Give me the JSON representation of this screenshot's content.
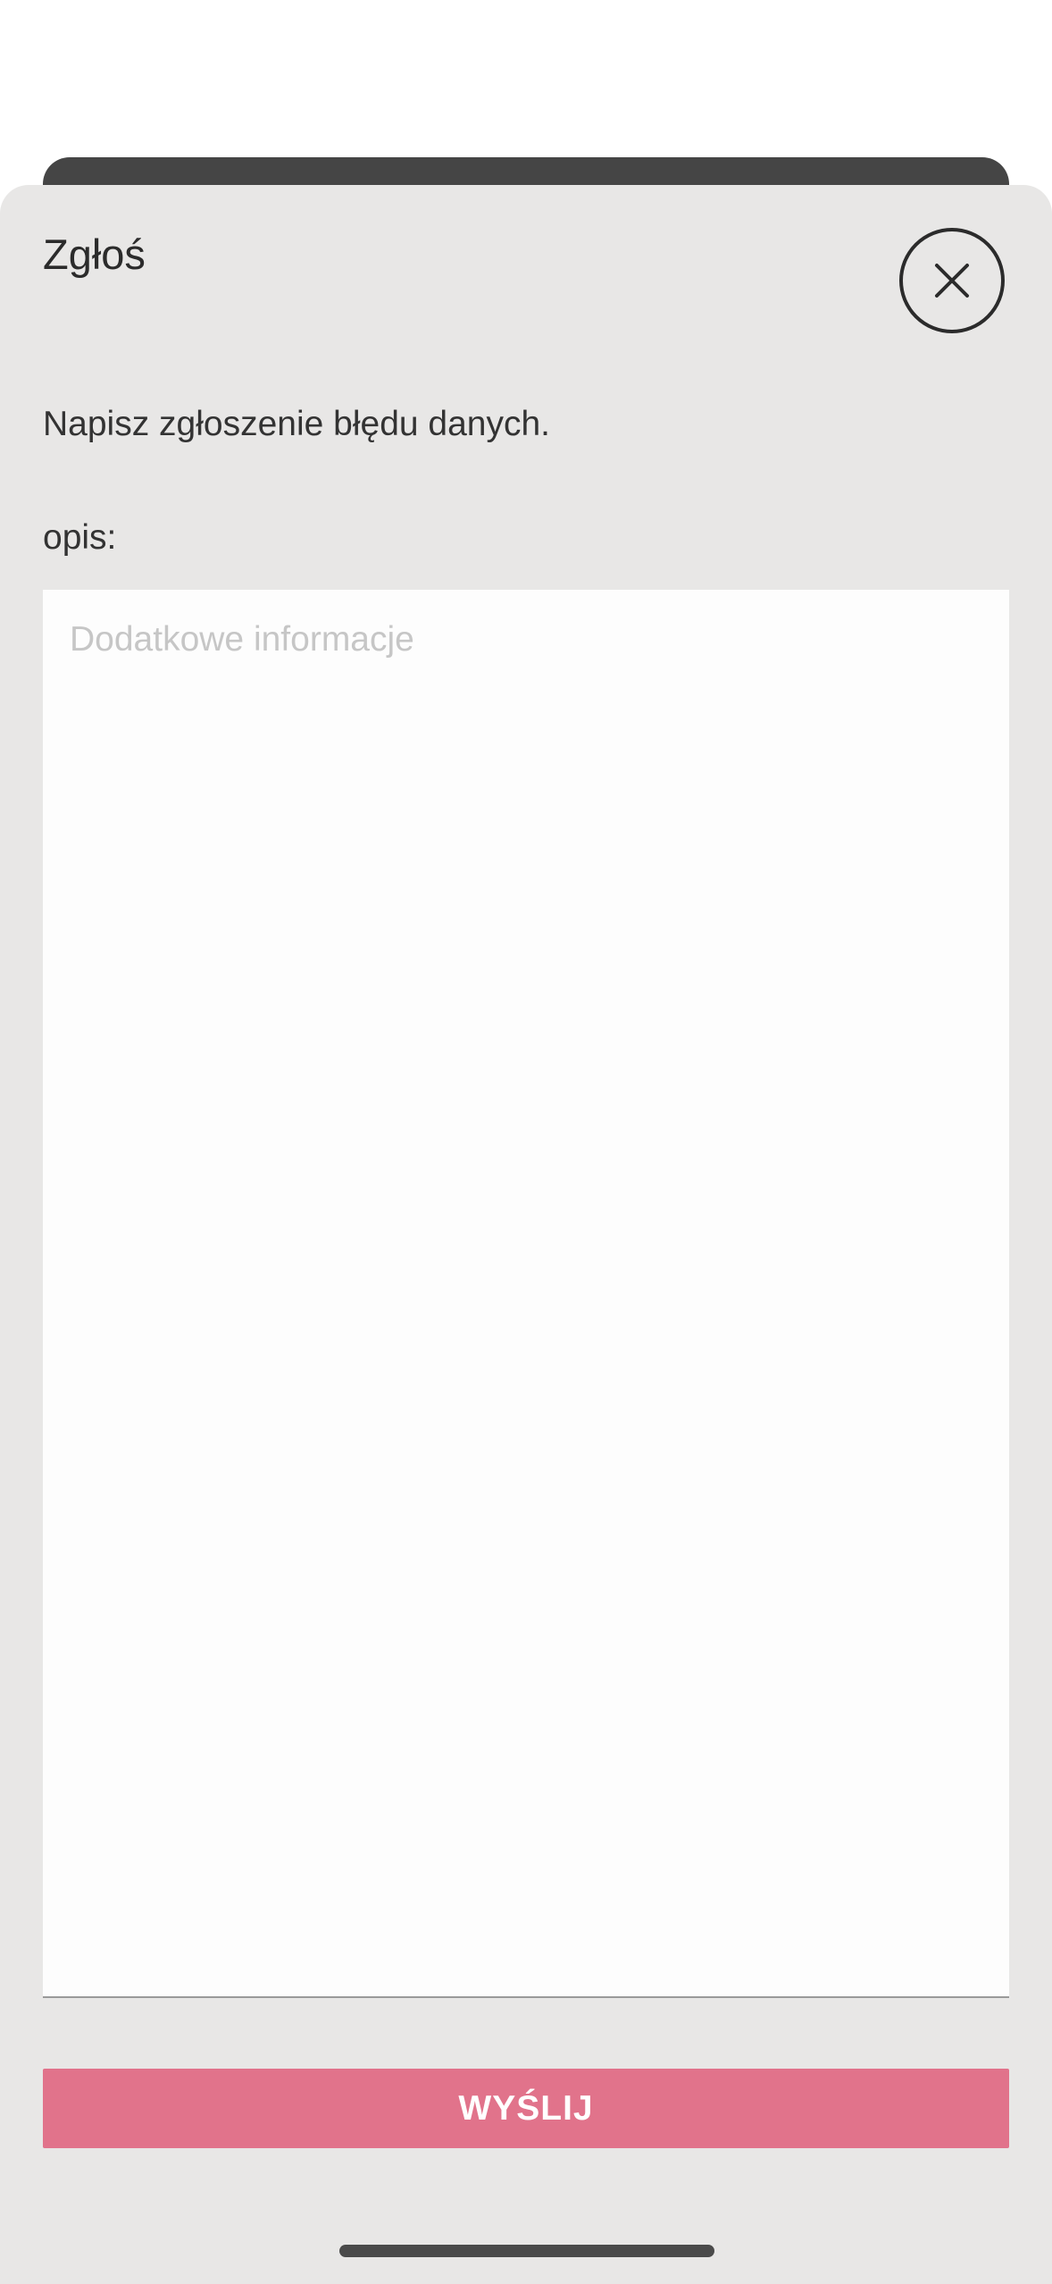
{
  "modal": {
    "title": "Zgłoś",
    "description": "Napisz zgłoszenie błędu danych.",
    "field_label": "opis:",
    "field_value": "",
    "field_placeholder": "Dodatkowe informacje",
    "submit_label": "WYŚLIJ",
    "close_icon": "close-icon"
  },
  "colors": {
    "sheet_background": "#e8e7e6",
    "submit_button": "#e1738b",
    "backdrop_card": "#454545"
  }
}
